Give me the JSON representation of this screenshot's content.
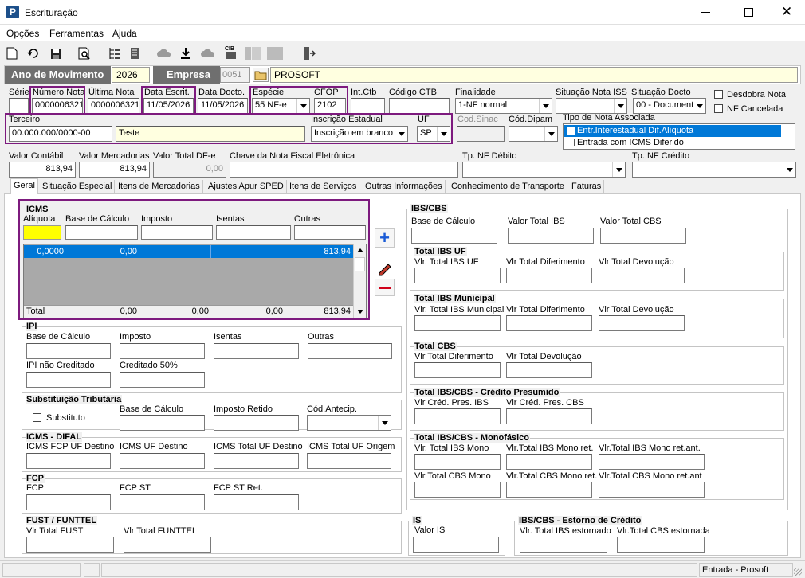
{
  "window": {
    "title": "Escrituração"
  },
  "menu": [
    "Opções",
    "Ferramentas",
    "Ajuda"
  ],
  "toolbar_icons": [
    "new-icon",
    "undo-icon",
    "save-icon",
    "preview-icon",
    "tree-icon",
    "document-icon",
    "cloud-icon",
    "export-icon",
    "cloud-icon",
    "cib-icon",
    "panel-icon",
    "panel-icon",
    "exit-icon"
  ],
  "year_bar": {
    "ano_label": "Ano de Movimento",
    "ano_value": "2026",
    "empresa_label": "Empresa",
    "empresa_code": "0051",
    "empresa_name": "PROSOFT"
  },
  "header": {
    "serie_label": "Série",
    "serie_value": "",
    "numero_label": "Número Nota",
    "numero_value": "0000006321",
    "ultima_label": "Última Nota",
    "ultima_value": "0000006321",
    "data_escrit_label": "Data Escrit.",
    "data_escrit_value": "11/05/2026",
    "data_docto_label": "Data Docto.",
    "data_docto_value": "11/05/2026",
    "especie_label": "Espécie",
    "especie_value": "55   NF-e",
    "cfop_label": "CFOP",
    "cfop_value": "2102",
    "intctb_label": "Int.Ctb",
    "intctb_value": "",
    "codctb_label": "Código CTB",
    "codctb_value": "",
    "finalidade_label": "Finalidade",
    "finalidade_value": "1-NF normal",
    "sit_iss_label": "Situação Nota ISS",
    "sit_iss_value": "",
    "sit_docto_label": "Situação Docto",
    "sit_docto_value": "00 - Document",
    "desdobra_label": "Desdobra Nota",
    "cancelada_label": "NF Cancelada",
    "terceiro_label": "Terceiro",
    "terceiro_cnpj": "00.000.000/0000-00",
    "terceiro_nome": "Teste",
    "ie_label": "Inscrição Estadual",
    "ie_value": "Inscrição em branco",
    "uf_label": "UF",
    "uf_value": "SP",
    "codsinac_label": "Cod.Sinac",
    "coddipam_label": "Cód.Dipam",
    "tipo_assoc_label": "Tipo de Nota Associada",
    "tipo_assoc_items": [
      "Entr.Interestadual Dif.Alíquota",
      "Entrada com ICMS Diferido"
    ],
    "valor_contabil_label": "Valor Contábil",
    "valor_contabil": "813,94",
    "valor_merc_label": "Valor Mercadorias",
    "valor_merc": "813,94",
    "valor_dfe_label": "Valor Total DF-e",
    "valor_dfe": "0,00",
    "chave_label": "Chave da Nota Fiscal Eletrônica",
    "chave_value": "",
    "tp_debito_label": "Tp. NF Débito",
    "tp_credito_label": "Tp. NF Crédito"
  },
  "tabs": [
    "Geral",
    "Situação Especial",
    "Itens de Mercadorias",
    "Ajustes Apur SPED",
    "Itens de Serviços",
    "Outras Informações",
    "Conhecimento de Transporte",
    "Faturas"
  ],
  "icms": {
    "title": "ICMS",
    "aliquota": "Alíquota",
    "base": "Base de Cálculo",
    "imposto": "Imposto",
    "isentas": "Isentas",
    "outras": "Outras",
    "row": [
      "0,0000",
      "0,00",
      "",
      "",
      "813,94"
    ],
    "total_label": "Total",
    "totals": [
      "0,00",
      "0,00",
      "0,00",
      "813,94"
    ]
  },
  "ipi": {
    "title": "IPI",
    "base": "Base de Cálculo",
    "imposto": "Imposto",
    "isentas": "Isentas",
    "outras": "Outras",
    "nao_cred": "IPI não Creditado",
    "cred50": "Creditado 50%"
  },
  "st": {
    "title": "Substituição Tributária",
    "substituto": "Substituto",
    "base": "Base de Cálculo",
    "retido": "Imposto Retido",
    "antecip": "Cód.Antecip."
  },
  "difal": {
    "title": "ICMS - DIFAL",
    "f1": "ICMS FCP UF Destino",
    "f2": "ICMS UF Destino",
    "f3": "ICMS Total UF Destino",
    "f4": "ICMS Total UF Origem"
  },
  "fcp": {
    "title": "FCP",
    "f1": "FCP",
    "f2": "FCP ST",
    "f3": "FCP ST Ret."
  },
  "fust": {
    "title": "FUST / FUNTTEL",
    "f1": "Vlr Total FUST",
    "f2": "Vlr Total FUNTTEL"
  },
  "ibscbs": {
    "title": "IBS/CBS",
    "f1": "Base de Cálculo",
    "f2": "Valor Total IBS",
    "f3": "Valor Total CBS"
  },
  "ibsuf": {
    "title": "Total IBS UF",
    "f1": "Vlr. Total IBS UF",
    "f2": "Vlr Total Diferimento",
    "f3": "Vlr Total Devolução"
  },
  "ibsmun": {
    "title": "Total IBS Municipal",
    "f1": "Vlr. Total IBS Municipal",
    "f2": "Vlr Total Diferimento",
    "f3": "Vlr Total Devolução"
  },
  "cbs": {
    "title": "Total CBS",
    "f1": "Vlr Total Diferimento",
    "f2": "Vlr Total Devolução"
  },
  "presumido": {
    "title": "Total IBS/CBS - Crédito Presumido",
    "f1": "Vlr Créd. Pres. IBS",
    "f2": "Vlr Créd. Pres. CBS"
  },
  "mono": {
    "title": "Total IBS/CBS - Monofásico",
    "f1": "Vlr. Total IBS Mono",
    "f2": "Vlr.Total IBS Mono ret.",
    "f3": "Vlr.Total IBS Mono ret.ant.",
    "f4": "Vlr Total CBS Mono",
    "f5": "Vlr.Total CBS Mono ret.",
    "f6": "Vlr.Total CBS Mono ret.ant"
  },
  "is": {
    "title": "IS",
    "f1": "Valor IS"
  },
  "estorno": {
    "title": "IBS/CBS - Estorno de Crédito",
    "f1": "Vlr. Total IBS estornado",
    "f2": "Vlr.Total CBS estornada"
  },
  "status": {
    "right": "Entrada - Prosoft"
  }
}
